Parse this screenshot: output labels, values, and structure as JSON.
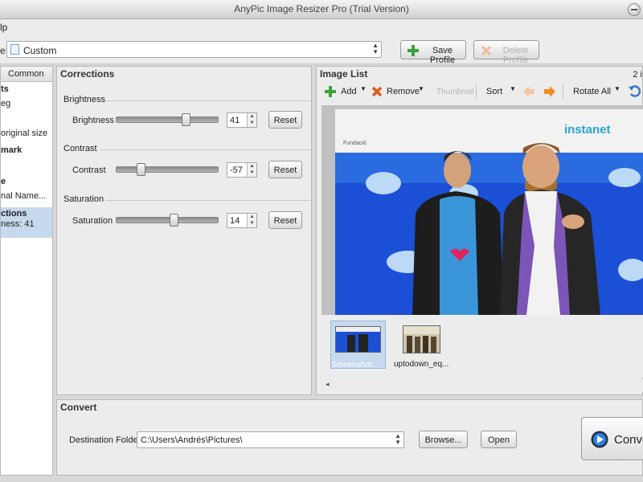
{
  "window": {
    "title": "AnyPic Image Resizer Pro (Trial Version)"
  },
  "menu": {
    "help_fragment": "lp"
  },
  "profile": {
    "label_fragment": "e:",
    "selected": "Custom",
    "save_label": "Save Profile",
    "delete_label": "Delete Profile"
  },
  "sidebar": {
    "header": "Common",
    "items": [
      "ts",
      "eg",
      "original size",
      "mark",
      "e",
      "nal Name...",
      "ctions",
      "ness: 41"
    ]
  },
  "corrections": {
    "title": "Corrections",
    "brightness": {
      "group": "Brightness",
      "label": "Brightness",
      "value": "41",
      "reset": "Reset",
      "level": 0.705
    },
    "contrast": {
      "group": "Contrast",
      "label": "Contrast",
      "value": "-57",
      "reset": "Reset",
      "level": 0.215
    },
    "saturation": {
      "group": "Saturation",
      "label": "Saturation",
      "value": "14",
      "reset": "Reset",
      "level": 0.57
    }
  },
  "image_list": {
    "title": "Image List",
    "count_fragment": "2 i",
    "toolbar": {
      "add": "Add",
      "remove": "Remove",
      "thumbnail": "Thumbnail",
      "sort": "Sort",
      "rotate_all": "Rotate All"
    },
    "banner_left": "Fundació",
    "banner_right": "instanet",
    "thumbnails": [
      {
        "caption": "Screenshot...",
        "selected": true
      },
      {
        "caption": "uptodown_eq...",
        "selected": false
      }
    ]
  },
  "convert": {
    "title": "Convert",
    "dest_label": "Destination Folder:",
    "dest_value": "C:\\Users\\Andrés\\Pictures\\",
    "browse": "Browse...",
    "open": "Open",
    "convert_button_fragment": "Conve"
  },
  "colors": {
    "accent": "#2f7fd8",
    "add_green": "#3aa23a",
    "remove_orange": "#e05a1c",
    "arrow_orange": "#f08a24",
    "photo_blue": "#1b4fd6"
  }
}
